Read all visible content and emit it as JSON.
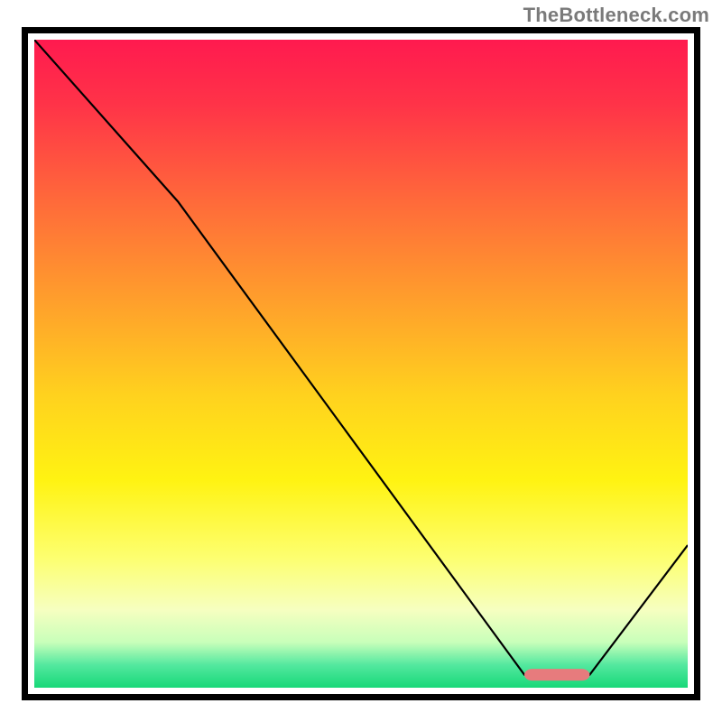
{
  "watermark": "TheBottleneck.com",
  "colors": {
    "frame": "#000000",
    "curve": "#000000",
    "marker_fill": "#e77b7d",
    "gradient_stops": [
      {
        "offset": 0.0,
        "color": "#ff1a4f"
      },
      {
        "offset": 0.1,
        "color": "#ff3348"
      },
      {
        "offset": 0.25,
        "color": "#ff6a3a"
      },
      {
        "offset": 0.4,
        "color": "#ff9e2c"
      },
      {
        "offset": 0.55,
        "color": "#ffd21e"
      },
      {
        "offset": 0.68,
        "color": "#fff312"
      },
      {
        "offset": 0.8,
        "color": "#fdff70"
      },
      {
        "offset": 0.88,
        "color": "#f6ffc0"
      },
      {
        "offset": 0.93,
        "color": "#c8ffba"
      },
      {
        "offset": 0.965,
        "color": "#53e89f"
      },
      {
        "offset": 1.0,
        "color": "#17d878"
      }
    ]
  },
  "chart_data": {
    "type": "line",
    "title": "",
    "xlabel": "",
    "ylabel": "",
    "xlim": [
      0,
      100
    ],
    "ylim": [
      0,
      100
    ],
    "x": [
      0,
      22,
      75,
      80,
      85,
      100
    ],
    "values": [
      100,
      75,
      2,
      2,
      2,
      22
    ],
    "optimal_marker": {
      "x_start": 75,
      "x_end": 85,
      "y": 2
    },
    "notes": "Black curve descends from top-left, slope steepens after x≈22, reaches a flat minimum (marked with a rounded red bar) around x≈75–85 near the bottom, then rises toward the right edge. Background is a vertical red→orange→yellow→pale→green gradient."
  }
}
